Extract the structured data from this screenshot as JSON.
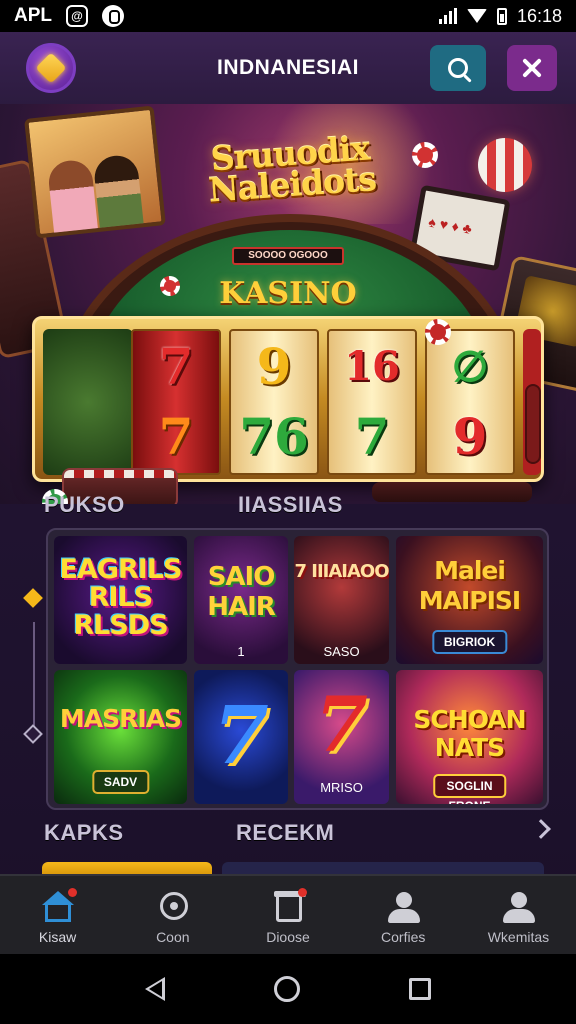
{
  "status_bar": {
    "carrier": "APL",
    "time": "16:18"
  },
  "header": {
    "title": "INDNANESIAI"
  },
  "hero": {
    "title": "Sruuodix Naleidots",
    "plaque": "SOOOO OGOOO",
    "table_label": "KASINO",
    "reels": [
      {
        "top": "7",
        "bottom": "7"
      },
      {
        "top": "9",
        "bottom": "76"
      },
      {
        "top": "16",
        "bottom": "7"
      },
      {
        "top": "∅",
        "bottom": "9"
      }
    ]
  },
  "sections": {
    "left": "PUKSO",
    "right": "IIASSIIAS",
    "bottom_left": "KAPKS",
    "bottom_right": "RECEKM"
  },
  "tiles": [
    {
      "title": "EAGRILS RILS RLSDS",
      "sub": ""
    },
    {
      "title": "SAIO HAIR",
      "sub": "1"
    },
    {
      "title": "7 IIIAIAOO",
      "sub": "SASO"
    },
    {
      "title": "Malei MAIPISI",
      "pill": "BIGRIOK"
    },
    {
      "title": "MASRIAS",
      "pill": "SADV"
    },
    {
      "title": "7",
      "sub": ""
    },
    {
      "title": "7",
      "sub": "MRISO"
    },
    {
      "title": "SCHOAN NATS",
      "pill": "SOGLIN FRONE"
    }
  ],
  "bottom_nav": [
    {
      "label": "Kisaw",
      "icon": "home-icon"
    },
    {
      "label": "Coon",
      "icon": "chat-icon"
    },
    {
      "label": "Dioose",
      "icon": "box-icon"
    },
    {
      "label": "Corfies",
      "icon": "user-icon"
    },
    {
      "label": "Wkemitas",
      "icon": "user-icon"
    }
  ],
  "colors": {
    "accent": "#f5b81a",
    "header": "#2c1b3f",
    "search_btn": "#1f6b82",
    "close_btn": "#7b2b8c",
    "nav_active": "#2f8fd6"
  }
}
